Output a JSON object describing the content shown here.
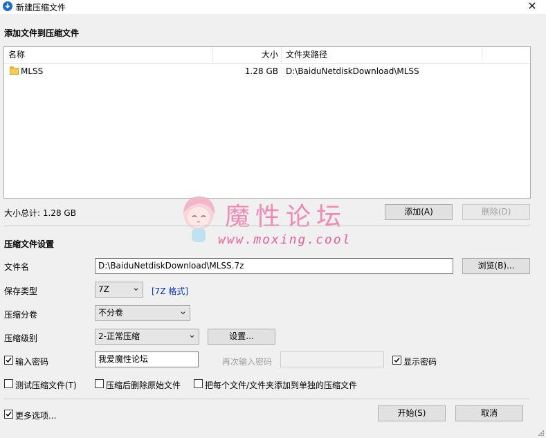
{
  "window": {
    "title": "新建压缩文件",
    "close_glyph": "✕"
  },
  "files_section": {
    "title": "添加文件到压缩文件",
    "columns": {
      "name": "名称",
      "size": "大小",
      "path": "文件夹路径"
    },
    "rows": [
      {
        "icon": "folder-icon",
        "name": "MLSS",
        "size": "1.28 GB",
        "path": "D:\\BaiduNetdiskDownload\\MLSS"
      }
    ],
    "total_size": "大小总计: 1.28 GB",
    "add_button": "添加(A)",
    "delete_button": "删除(D)"
  },
  "settings": {
    "title": "压缩文件设置",
    "filename_label": "文件名",
    "filename_value": "D:\\BaiduNetdiskDownload\\MLSS.7z",
    "browse_button": "浏览(B)...",
    "type_label": "保存类型",
    "type_value": "7Z",
    "type_link": "[7Z 格式]",
    "split_label": "压缩分卷",
    "split_value": "不分卷",
    "level_label": "压缩级别",
    "level_value": "2-正常压缩",
    "settings_button": "设置...",
    "password_checkbox_label": "输入密码",
    "password_checked": true,
    "password_value": "我爱魔性论坛",
    "reenter_label": "再次输入密码",
    "reenter_value": "",
    "show_password_label": "显示密码",
    "show_password_checked": true,
    "test_label": "测试压缩文件(T)",
    "delete_after_label": "压缩后删除原始文件",
    "separate_label": "把每个文件/文件夹添加到单独的压缩文件"
  },
  "footer": {
    "more_options_label": "更多选项...",
    "more_options_checked": true,
    "start_button": "开始(S)",
    "cancel_button": "取消"
  },
  "watermark": {
    "title": "魔性论坛",
    "url": "www.moxing.cool"
  },
  "colors": {
    "link": "#0033cc",
    "watermark_pink": "#f08ab4",
    "folder": "#f5cd56"
  }
}
